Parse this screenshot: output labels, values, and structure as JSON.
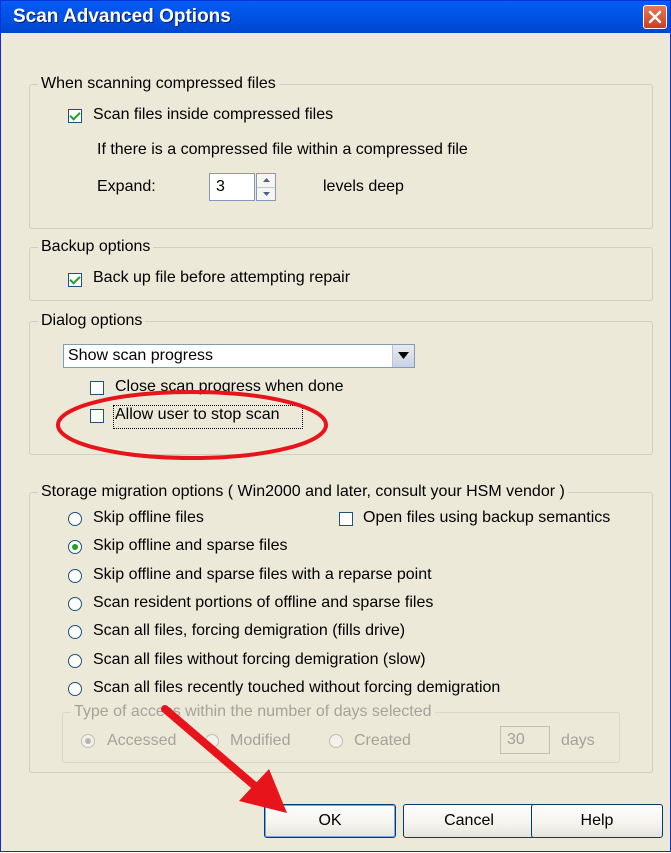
{
  "window": {
    "title": "Scan Advanced Options",
    "close_icon": "close-icon"
  },
  "compressed": {
    "legend": "When scanning compressed files",
    "scan_inside_label": "Scan files inside compressed files",
    "scan_inside_checked": true,
    "nested_note": "If there is a compressed file within a compressed file",
    "expand_label": "Expand:",
    "expand_value": "3",
    "levels_label": "levels deep"
  },
  "backup": {
    "legend": "Backup options",
    "backup_label": "Back up file before attempting repair",
    "backup_checked": true
  },
  "dialog": {
    "legend": "Dialog options",
    "progress_select_value": "Show scan progress",
    "close_when_done_label": "Close scan progress when done",
    "close_when_done_checked": false,
    "allow_stop_label": "Allow user to stop scan",
    "allow_stop_checked": false
  },
  "storage": {
    "legend": "Storage migration options ( Win2000 and later, consult your HSM vendor )",
    "open_backup_label": "Open files using backup semantics",
    "open_backup_checked": false,
    "options": [
      {
        "label": "Skip offline files",
        "selected": false
      },
      {
        "label": "Skip offline and sparse files",
        "selected": true
      },
      {
        "label": "Skip offline and sparse files with a reparse point",
        "selected": false
      },
      {
        "label": "Scan resident portions of offline and sparse files",
        "selected": false
      },
      {
        "label": "Scan all files, forcing demigration (fills drive)",
        "selected": false
      },
      {
        "label": "Scan all files without forcing demigration (slow)",
        "selected": false
      },
      {
        "label": "Scan all files recently touched without forcing demigration",
        "selected": false
      }
    ],
    "access": {
      "legend": "Type of access within the number of days selected",
      "accessed_label": "Accessed",
      "modified_label": "Modified",
      "created_label": "Created",
      "selected": "Accessed",
      "days_value": "30",
      "days_label": "days"
    }
  },
  "buttons": {
    "ok": "OK",
    "cancel": "Cancel",
    "help": "Help"
  },
  "colors": {
    "annotation_red": "#e8141c",
    "title_blue": "#0054e3"
  }
}
